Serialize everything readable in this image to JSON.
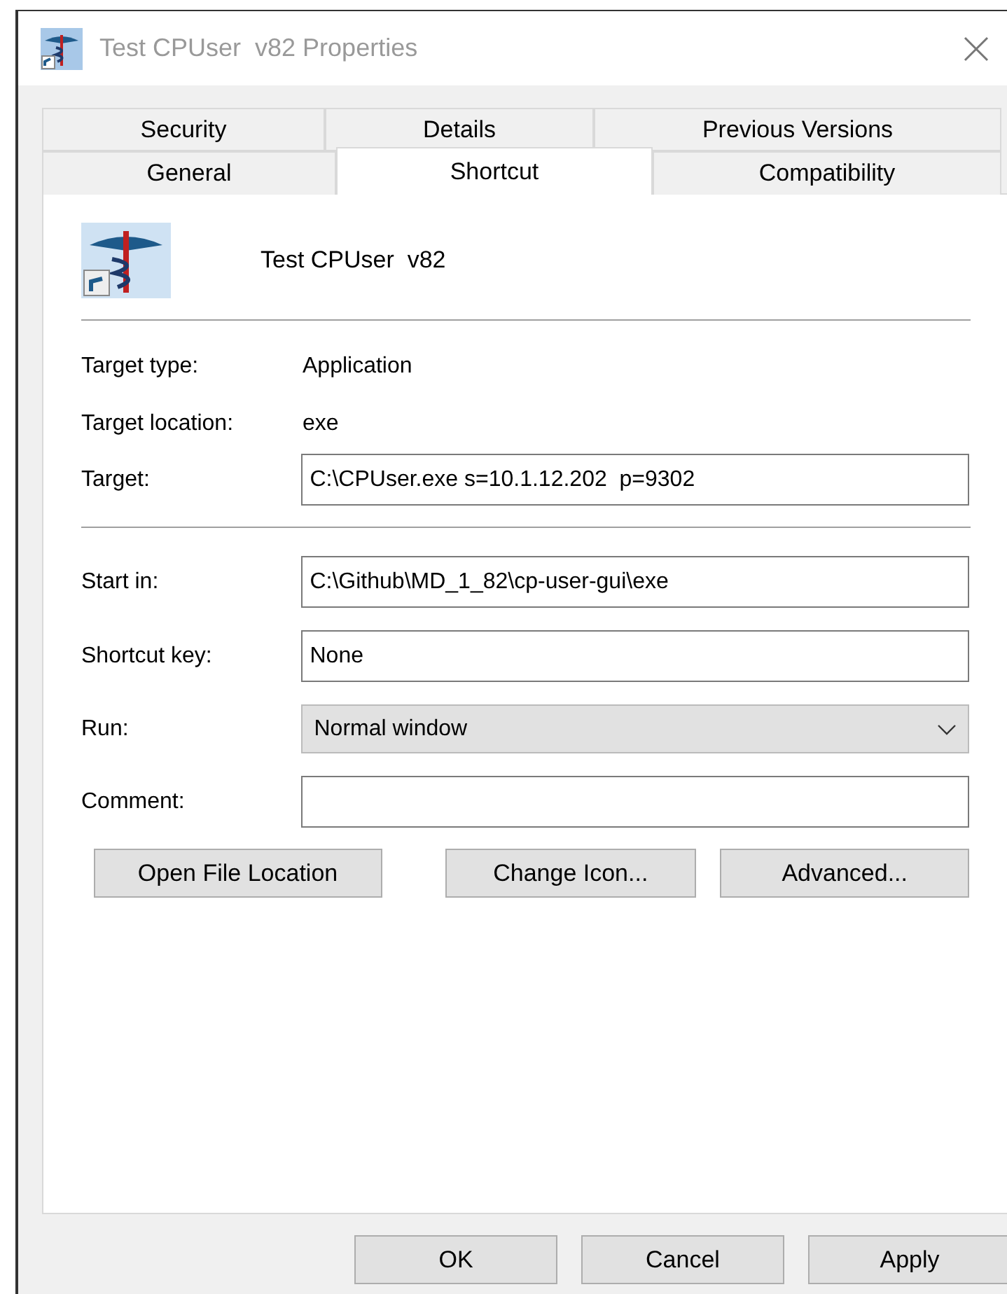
{
  "window": {
    "title": "Test CPUser  v82 Properties"
  },
  "tab_rows": [
    [
      {
        "label": "Security",
        "selected": false
      },
      {
        "label": "Details",
        "selected": false
      },
      {
        "label": "Previous Versions",
        "selected": false
      }
    ],
    [
      {
        "label": "General",
        "selected": false
      },
      {
        "label": "Shortcut",
        "selected": true
      },
      {
        "label": "Compatibility",
        "selected": false
      }
    ]
  ],
  "shortcut_name": "Test CPUser  v82",
  "info": [
    {
      "label": "Target type:",
      "value": "Application"
    },
    {
      "label": "Target location:",
      "value": "exe"
    }
  ],
  "target": {
    "label": "Target:",
    "value": "C:\\CPUser.exe s=10.1.12.202  p=9302"
  },
  "fields": [
    {
      "kind": "text",
      "label": "Start in:",
      "value": "C:\\Github\\MD_1_82\\cp-user-gui\\exe"
    },
    {
      "kind": "text",
      "label": "Shortcut key:",
      "value": "None"
    },
    {
      "kind": "select",
      "label": "Run:",
      "value": "Normal window"
    },
    {
      "kind": "text",
      "label": "Comment:"
    }
  ],
  "action_buttons": [
    "Open File Location",
    "Change Icon...",
    "Advanced..."
  ],
  "dialog_buttons": [
    "OK",
    "Cancel",
    "Apply"
  ]
}
